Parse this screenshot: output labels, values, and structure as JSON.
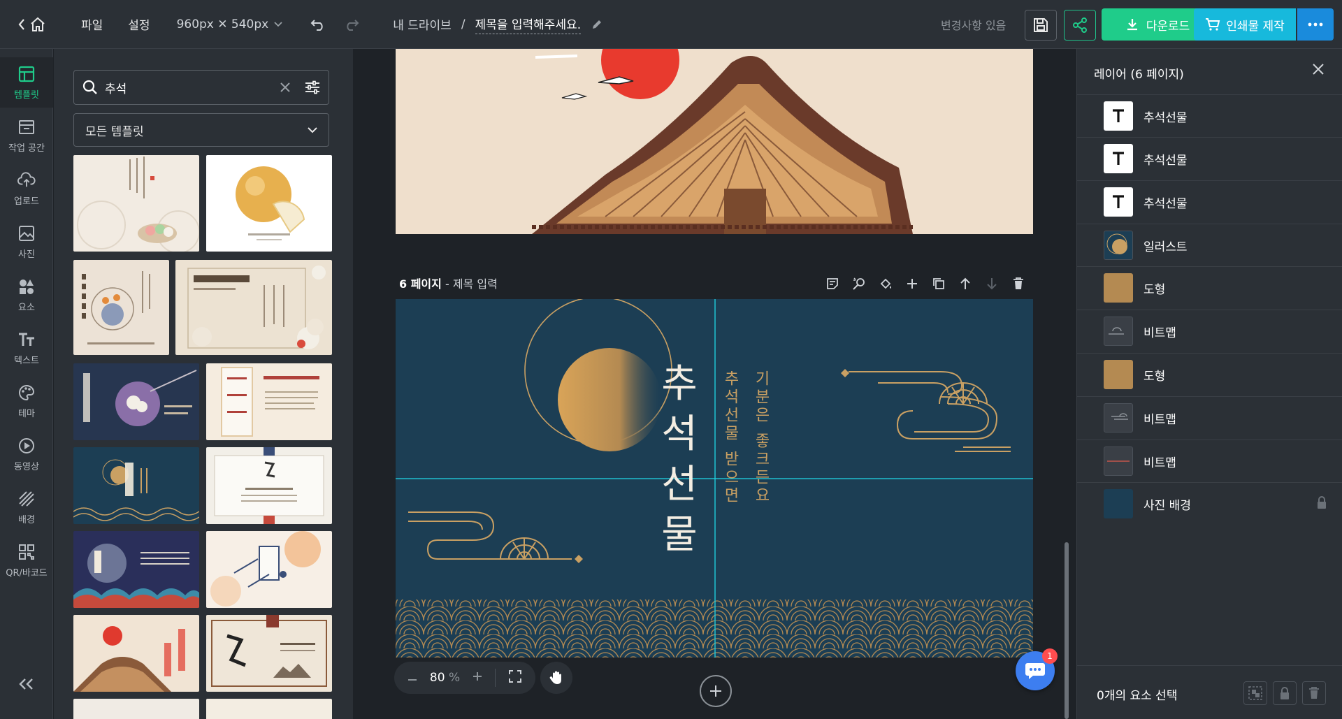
{
  "topbar": {
    "menu_file": "파일",
    "menu_settings": "설정",
    "canvas_size": "960px ✕ 540px",
    "breadcrumb_drive": "내 드라이브",
    "breadcrumb_sep": "/",
    "doc_title": "제목을 입력해주세요.",
    "status": "변경사항 있음",
    "download_label": "다운로드",
    "print_label": "인쇄물 제작"
  },
  "rail": {
    "items": [
      {
        "label": "템플릿",
        "icon": "template-icon",
        "active": true
      },
      {
        "label": "작업 공간",
        "icon": "workspace-icon"
      },
      {
        "label": "업로드",
        "icon": "upload-icon"
      },
      {
        "label": "사진",
        "icon": "photo-icon"
      },
      {
        "label": "요소",
        "icon": "elements-icon"
      },
      {
        "label": "텍스트",
        "icon": "text-icon"
      },
      {
        "label": "테마",
        "icon": "theme-icon"
      },
      {
        "label": "동영상",
        "icon": "video-icon"
      },
      {
        "label": "배경",
        "icon": "background-icon"
      },
      {
        "label": "QR/바코드",
        "icon": "qr-icon"
      }
    ],
    "collapse_icon": "double-chevron-left-icon"
  },
  "templates": {
    "search_value": "추석",
    "filter_selected": "모든 템플릿"
  },
  "canvas": {
    "page_number": "6 페이지",
    "page_title_suffix": " - 제목 입력",
    "slide_title_chars": [
      "추",
      "석",
      "선",
      "물"
    ],
    "slide_sub_col1": "추석선물 받으면",
    "slide_sub_col2": "기분은 좋크든요",
    "zoom_value": "80",
    "zoom_unit": "%",
    "chat_badge": "1"
  },
  "layers": {
    "title": "레이어 (6 페이지)",
    "items": [
      {
        "label": "추석선물",
        "kind": "text"
      },
      {
        "label": "추석선물",
        "kind": "text"
      },
      {
        "label": "추석선물",
        "kind": "text"
      },
      {
        "label": "일러스트",
        "kind": "illust"
      },
      {
        "label": "도형",
        "kind": "shape"
      },
      {
        "label": "비트맵",
        "kind": "bitmap"
      },
      {
        "label": "도형",
        "kind": "shape"
      },
      {
        "label": "비트맵",
        "kind": "bitmap"
      },
      {
        "label": "비트맵",
        "kind": "bitmap-line"
      },
      {
        "label": "사진 배경",
        "kind": "photo",
        "locked": true
      }
    ],
    "selection_status": "0개의 요소 선택"
  },
  "colors": {
    "accent_green": "#1fcc8a",
    "accent_cyan": "#17b9dc",
    "accent_blue": "#1a8bdc",
    "slide_navy": "#1c3e54",
    "slide_gold": "#c9a063"
  }
}
